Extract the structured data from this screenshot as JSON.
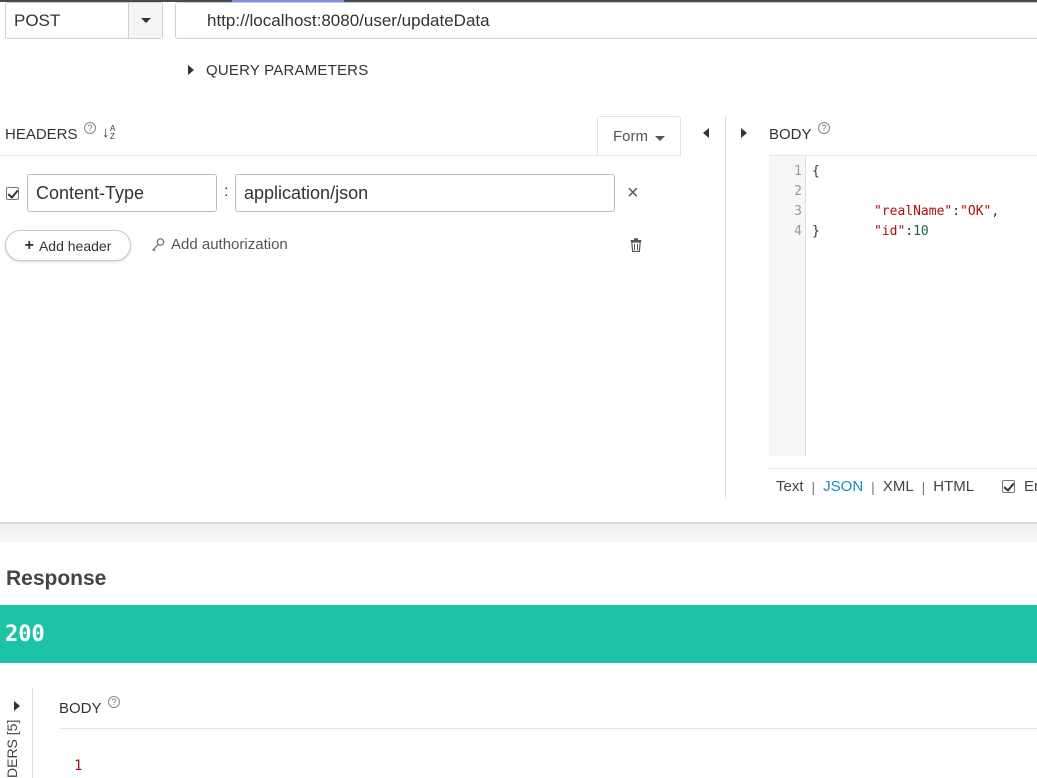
{
  "request": {
    "method": "POST",
    "url": "http://localhost:8080/user/updateData",
    "query_parameters_label": "QUERY PARAMETERS"
  },
  "headers": {
    "title": "HEADERS",
    "help": "?",
    "form_tab_label": "Form",
    "rows": [
      {
        "checked": true,
        "key": "Content-Type",
        "value": "application/json"
      }
    ],
    "add_header_label": "Add header",
    "add_authorization_label": "Add authorization"
  },
  "body": {
    "title": "BODY",
    "help": "?",
    "lines": [
      {
        "n": "1",
        "text": "{"
      },
      {
        "n": "2",
        "key": "\"realName\"",
        "sep": ":",
        "value": "\"OK\"",
        "tail": ","
      },
      {
        "n": "3",
        "key": "\"id\"",
        "sep": ":",
        "value": "10",
        "tail": ""
      },
      {
        "n": "4",
        "text": "}"
      }
    ],
    "formats": [
      "Text",
      "JSON",
      "XML",
      "HTML"
    ],
    "active_format": "JSON",
    "encode_label": "Er"
  },
  "response": {
    "title": "Response",
    "status": "200",
    "status_color": "#1dc3a7",
    "headers_label": "DERS [5]",
    "body_title": "BODY",
    "body_help": "?",
    "first_line_number": "1"
  }
}
